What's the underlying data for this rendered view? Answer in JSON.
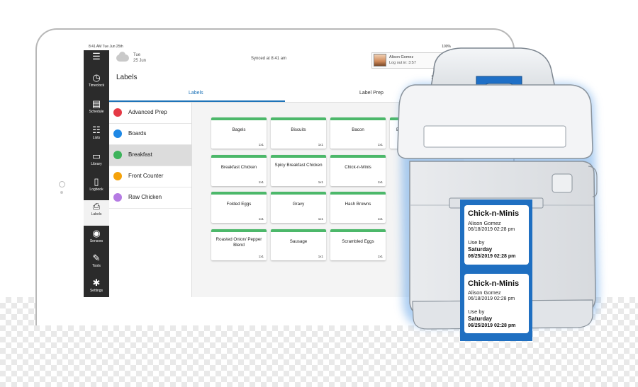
{
  "status": {
    "time": "8:41 AM Tue Jun 25th",
    "right": "100%"
  },
  "weather": {
    "day": "Tue",
    "date": "25 Jun"
  },
  "sync": "Synced at 8:41 am",
  "user": {
    "name": "Alison Gomez",
    "logout": "Log out in: 3:57"
  },
  "page_title": "Labels",
  "tabs": [
    {
      "label": "Labels"
    },
    {
      "label": "Label Prep"
    }
  ],
  "rail": [
    {
      "icon": "☰",
      "label": ""
    },
    {
      "icon": "◷",
      "label": "Timeclock"
    },
    {
      "icon": "▤",
      "label": "Schedule"
    },
    {
      "icon": "☷",
      "label": "Lists"
    },
    {
      "icon": "▭",
      "label": "Library"
    },
    {
      "icon": "▯",
      "label": "Logbook"
    },
    {
      "icon": "⎙",
      "label": "Labels"
    },
    {
      "icon": "◉",
      "label": "Sensors"
    },
    {
      "icon": "✎",
      "label": "Tools"
    },
    {
      "icon": "✱",
      "label": "Settings"
    }
  ],
  "categories": [
    {
      "name": "Advanced Prep",
      "color": "#e53945"
    },
    {
      "name": "Boards",
      "color": "#1e88e5"
    },
    {
      "name": "Breakfast",
      "color": "#3cb35a"
    },
    {
      "name": "Front Counter",
      "color": "#f5a20a"
    },
    {
      "name": "Raw Chicken",
      "color": "#b57be3"
    }
  ],
  "tiles": [
    {
      "name": "Bagels",
      "size": "1x1"
    },
    {
      "name": "Biscuits",
      "size": "1x1"
    },
    {
      "name": "Bacon",
      "size": "1x1"
    },
    {
      "name": "Bre",
      "size": ""
    },
    {
      "name": "Breakfast Chicken",
      "size": "1x1"
    },
    {
      "name": "Spicy Breakfast Chicken",
      "size": "1x1"
    },
    {
      "name": "Chick-n-Minis",
      "size": "1x1"
    },
    {
      "name": "Folded Eggs",
      "size": "1x1"
    },
    {
      "name": "Gravy",
      "size": "1x1"
    },
    {
      "name": "Hash Browns",
      "size": "1x1"
    },
    {
      "name": "Roasted Onion/ Pepper Blend",
      "size": "1x1"
    },
    {
      "name": "Sausage",
      "size": "1x1"
    },
    {
      "name": "Scrambled Eggs",
      "size": "1x1"
    }
  ],
  "labels": [
    {
      "title": "Chick-n-Minis",
      "user": "Alison Gomez",
      "made": "06/18/2019 02:28 pm",
      "use_by": "Use by",
      "day": "Saturday",
      "expires": "06/25/2019 02:28 pm"
    },
    {
      "title": "Chick-n-Minis",
      "user": "Alison Gomez",
      "made": "06/18/2019 02:28 pm",
      "use_by": "Use by",
      "day": "Saturday",
      "expires": "06/25/2019 02:28 pm"
    }
  ]
}
